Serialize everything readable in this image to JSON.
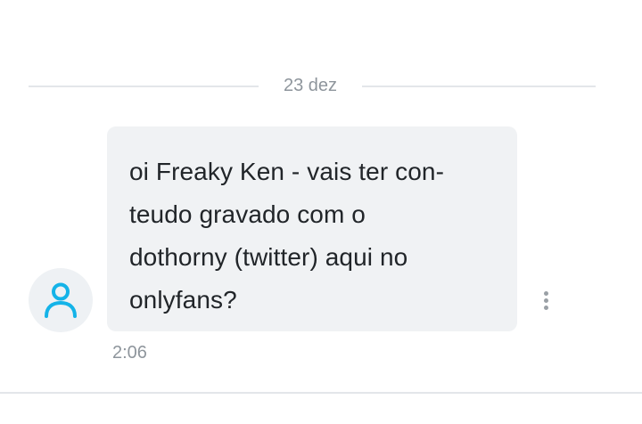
{
  "conversation": {
    "date_separator": "23 dez",
    "message": {
      "text": "oi Freaky Ken - vais ter con-\nteudo gravado com o\ndothorny (twitter) aqui no\nonlyfans?",
      "time": "2:06",
      "sender_avatar_icon": "user-icon",
      "options_icon": "more-vertical-icon"
    }
  },
  "colors": {
    "bubble_background": "#f0f2f4",
    "avatar_background": "#eef1f4",
    "avatar_icon": "#14b3e8",
    "muted_text": "#8e959c",
    "divider": "#e3e6ea"
  }
}
